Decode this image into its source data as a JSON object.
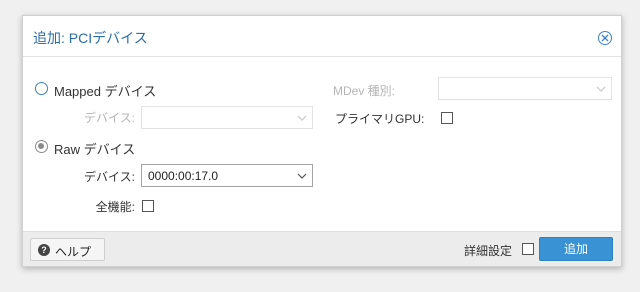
{
  "dialog": {
    "title": "追加: PCIデバイス",
    "close_icon": "close-icon"
  },
  "form": {
    "mapped_label": "Mapped デバイス",
    "mapped_device_label": "デバイス:",
    "mapped_device_value": "",
    "mdev_label": "MDev 種別:",
    "mdev_value": "",
    "primary_gpu_label": "プライマリGPU:",
    "raw_label": "Raw デバイス",
    "raw_device_label": "デバイス:",
    "raw_device_value": "0000:00:17.0",
    "all_functions_label": "全機能:",
    "selected_mode": "raw"
  },
  "footer": {
    "help_label": "ヘルプ",
    "help_icon": "question-icon",
    "advanced_label": "詳細設定",
    "add_label": "追加"
  },
  "colors": {
    "title": "#2a6da8",
    "primary_button": "#3892d4"
  }
}
